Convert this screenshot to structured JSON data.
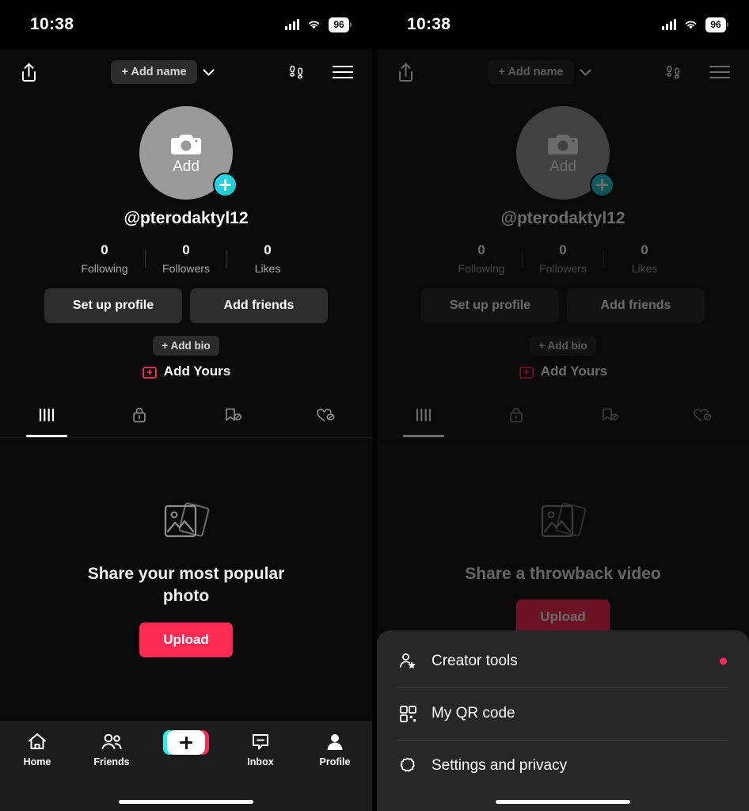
{
  "status_bar": {
    "time": "10:38",
    "battery_level": "96",
    "icons": [
      "signal-icon",
      "wifi-icon",
      "battery-icon"
    ]
  },
  "header": {
    "share_icon": "share-icon",
    "add_name_label": "+ Add name",
    "chevron_icon": "chevron-down-icon",
    "footprints_icon": "footprints-icon",
    "menu_icon": "hamburger-menu-icon"
  },
  "profile": {
    "avatar_add_label": "Add",
    "avatar_camera_icon": "camera-icon",
    "avatar_plus_badge": "plus-badge-icon",
    "username": "@pterodaktyl12",
    "stats": [
      {
        "value": "0",
        "label": "Following"
      },
      {
        "value": "0",
        "label": "Followers"
      },
      {
        "value": "0",
        "label": "Likes"
      }
    ],
    "buttons": [
      {
        "label": "Set up profile",
        "name": "set-up-profile-button"
      },
      {
        "label": "Add friends",
        "name": "add-friends-button"
      }
    ],
    "add_bio_label": "+ Add bio",
    "add_yours_label": "Add Yours",
    "add_yours_icon": "add-yours-sticker-icon",
    "add_yours_color": "#fe2c55"
  },
  "content_tabs": [
    {
      "name": "tab-posts",
      "icon": "grid-posts-icon",
      "active": true
    },
    {
      "name": "tab-private",
      "icon": "lock-icon",
      "active": false
    },
    {
      "name": "tab-saved",
      "icon": "bookmark-hidden-icon",
      "active": false
    },
    {
      "name": "tab-liked",
      "icon": "heart-hidden-icon",
      "active": false
    }
  ],
  "empty_state_left": {
    "icon": "photos-stack-icon",
    "title": "Share your most popular photo",
    "upload_label": "Upload",
    "upload_color": "#fe2c55"
  },
  "empty_state_right": {
    "icon": "photos-stack-icon",
    "title": "Share a throwback video",
    "upload_label": "Upload"
  },
  "bottom_nav": [
    {
      "name": "nav-home",
      "label": "Home",
      "icon": "home-icon"
    },
    {
      "name": "nav-friends",
      "label": "Friends",
      "icon": "friends-icon"
    },
    {
      "name": "nav-create",
      "label": "",
      "icon": "create-plus-icon"
    },
    {
      "name": "nav-inbox",
      "label": "Inbox",
      "icon": "inbox-icon"
    },
    {
      "name": "nav-profile",
      "label": "Profile",
      "icon": "person-icon"
    }
  ],
  "menu_sheet": {
    "items": [
      {
        "name": "menu-creator-tools",
        "label": "Creator tools",
        "icon": "person-star-icon",
        "badge": true
      },
      {
        "name": "menu-my-qr-code",
        "label": "My QR code",
        "icon": "qr-code-icon",
        "badge": false
      },
      {
        "name": "menu-settings-privacy",
        "label": "Settings and privacy",
        "icon": "gear-icon",
        "badge": false
      }
    ],
    "badge_color": "#fe2c55"
  }
}
